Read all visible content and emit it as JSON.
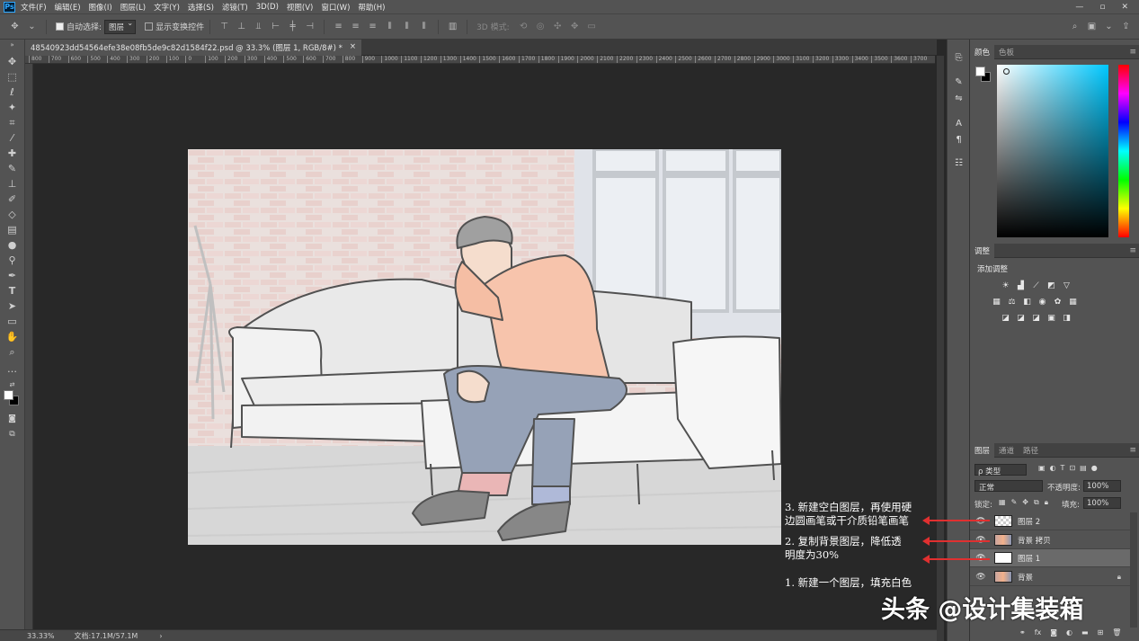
{
  "app": {
    "logo": "Ps"
  },
  "menubar": {
    "items": [
      "文件(F)",
      "编辑(E)",
      "图像(I)",
      "图层(L)",
      "文字(Y)",
      "选择(S)",
      "滤镜(T)",
      "3D(D)",
      "视图(V)",
      "窗口(W)",
      "帮助(H)"
    ],
    "window_controls": [
      "—",
      "▫",
      "✕"
    ]
  },
  "options": {
    "auto_select_label": "自动选择:",
    "auto_select_target": "图层",
    "show_transform_label": "显示变换控件",
    "mode_3d_label": "3D 模式:"
  },
  "document": {
    "tab_title": "48540923dd54564efe38e08fb5de9c82d1584f22.psd @ 33.3% (图层 1, RGB/8#) *",
    "tab_close": "×"
  },
  "ruler": {
    "ticks": [
      "800",
      "700",
      "600",
      "500",
      "400",
      "300",
      "200",
      "100",
      "0",
      "100",
      "200",
      "300",
      "400",
      "500",
      "600",
      "700",
      "800",
      "900",
      "1000",
      "1100",
      "1200",
      "1300",
      "1400",
      "1500",
      "1600",
      "1700",
      "1800",
      "1900",
      "2000",
      "2100",
      "2200",
      "2300",
      "2400",
      "2500",
      "2600",
      "2700",
      "2800",
      "2900",
      "3000",
      "3100",
      "3200",
      "3300",
      "3400",
      "3500",
      "3600",
      "3700"
    ]
  },
  "status": {
    "zoom": "33.33%",
    "doc_size": "文档:17.1M/57.1M",
    "arrow": "›"
  },
  "panels": {
    "color_tabs": [
      "颜色",
      "色板"
    ],
    "adjust_tab": "调整",
    "adjust_add": "添加调整",
    "layers_tabs": [
      "图层",
      "通道",
      "路径"
    ],
    "filter_kind": "ρ 类型",
    "blend_mode": "正常",
    "opacity_label": "不透明度:",
    "opacity_value": "100%",
    "lock_label": "锁定:",
    "fill_label": "填充:",
    "fill_value": "100%"
  },
  "layers": [
    {
      "name": "图层 2",
      "thumb": "transparent",
      "selected": false,
      "locked": false
    },
    {
      "name": "背景 拷贝",
      "thumb": "photo",
      "selected": false,
      "locked": false
    },
    {
      "name": "图层 1",
      "thumb": "white",
      "selected": true,
      "locked": false
    },
    {
      "name": "背景",
      "thumb": "photo",
      "selected": false,
      "locked": true
    }
  ],
  "annotations": {
    "step3_line1": "3. 新建空白图层，再使用硬",
    "step3_line2": "边圆画笔或干介质铅笔画笔",
    "step2_line1": "2. 复制背景图层，降低透",
    "step2_line2": "明度为30%",
    "step1": "1. 新建一个图层，填充白色"
  },
  "watermark": "头条 @设计集装箱",
  "colors": {
    "accent_arrow": "#e03030",
    "panel_bg": "#535353",
    "canvas_bg": "#282828"
  },
  "icons": {
    "tools": [
      "move-icon",
      "marquee-icon",
      "lasso-icon",
      "magic-wand-icon",
      "crop-icon",
      "eyedropper-icon",
      "healing-icon",
      "brush-icon",
      "stamp-icon",
      "history-brush-icon",
      "eraser-icon",
      "gradient-icon",
      "blur-icon",
      "dodge-icon",
      "pen-icon",
      "type-icon",
      "path-select-icon",
      "rectangle-icon",
      "hand-icon",
      "zoom-icon",
      "more-icon"
    ]
  }
}
